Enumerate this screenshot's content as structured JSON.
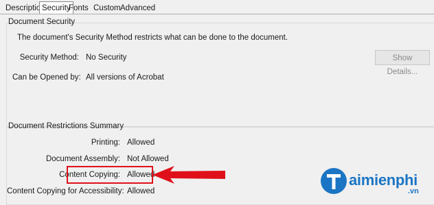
{
  "tabs": [
    {
      "label": "Description",
      "active": false
    },
    {
      "label": "Security",
      "active": true
    },
    {
      "label": "Fonts",
      "active": false
    },
    {
      "label": "Custom",
      "active": false
    },
    {
      "label": "Advanced",
      "active": false
    }
  ],
  "document_security": {
    "title": "Document Security",
    "message": "The document's Security Method restricts what can be done to the document.",
    "security_method_label": "Security Method:",
    "security_method_value": "No Security",
    "opened_by_label": "Can be Opened by:",
    "opened_by_value": "All versions of Acrobat",
    "show_details_label": "Show Details..."
  },
  "restrictions": {
    "title": "Document Restrictions Summary",
    "rows": [
      {
        "label": "Printing:",
        "value": "Allowed"
      },
      {
        "label": "Document Assembly:",
        "value": "Not Allowed"
      },
      {
        "label": "Content Copying:",
        "value": "Allowed"
      },
      {
        "label": "Content Copying for Accessibility:",
        "value": "Allowed"
      }
    ]
  },
  "annotation": {
    "color": "#e0101a",
    "arrow_direction": "left"
  },
  "watermark": {
    "text": "aimienphi",
    "suffix": ".vn",
    "color": "#1b75c4"
  }
}
